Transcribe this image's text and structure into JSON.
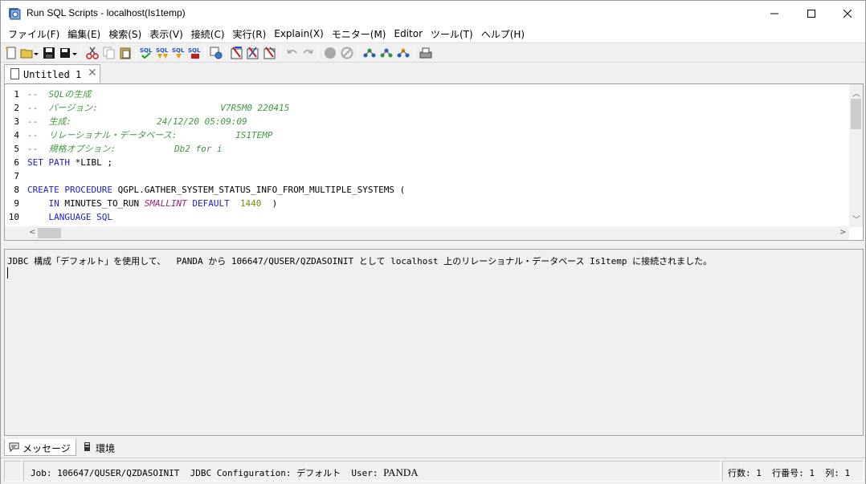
{
  "window": {
    "title": "Run SQL Scripts - localhost(Is1temp)",
    "minimize": "—",
    "maximize": "☐",
    "close": "✕"
  },
  "menu": [
    "ファイル(F)",
    "編集(E)",
    "検索(S)",
    "表示(V)",
    "接続(C)",
    "実行(R)",
    "Explain(X)",
    "モニター(M)",
    "Editor",
    "ツール(T)",
    "ヘルプ(H)"
  ],
  "tab": {
    "label": "Untitled 1",
    "close": "✕"
  },
  "editor": {
    "lines": [
      {
        "n": "1",
        "parts": [
          {
            "t": "--  SQLの生成",
            "c": "cmt"
          }
        ]
      },
      {
        "n": "2",
        "parts": [
          {
            "t": "--  バージョン:                       V7R5M0 220415",
            "c": "cmt"
          }
        ]
      },
      {
        "n": "3",
        "parts": [
          {
            "t": "--  生成:                24/12/20 05:09:09",
            "c": "cmt"
          }
        ]
      },
      {
        "n": "4",
        "parts": [
          {
            "t": "--  リレーショナル・データベース:           IS1TEMP",
            "c": "cmt"
          }
        ]
      },
      {
        "n": "5",
        "parts": [
          {
            "t": "--  規格オプション:           Db2 for i",
            "c": "cmt"
          }
        ]
      },
      {
        "n": "6",
        "parts": [
          {
            "t": "SET",
            "c": "kw"
          },
          {
            "t": " "
          },
          {
            "t": "PATH",
            "c": "kw"
          },
          {
            "t": " *LIBL ;"
          }
        ]
      },
      {
        "n": "7",
        "parts": []
      },
      {
        "n": "8",
        "parts": [
          {
            "t": "CREATE",
            "c": "kw"
          },
          {
            "t": " "
          },
          {
            "t": "PROCEDURE",
            "c": "kw"
          },
          {
            "t": " QGPL.GATHER_SYSTEM_STATUS_INFO_FROM_MULTIPLE_SYSTEMS ("
          }
        ]
      },
      {
        "n": "9",
        "parts": [
          {
            "t": "    "
          },
          {
            "t": "IN",
            "c": "kw"
          },
          {
            "t": " MINUTES_TO_RUN "
          },
          {
            "t": "SMALLINT",
            "c": "typ"
          },
          {
            "t": " "
          },
          {
            "t": "DEFAULT",
            "c": "kw"
          },
          {
            "t": "  "
          },
          {
            "t": "1440",
            "c": "num"
          },
          {
            "t": "  )"
          }
        ]
      },
      {
        "n": "10",
        "parts": [
          {
            "t": "    "
          },
          {
            "t": "LANGUAGE SQL",
            "c": "kw"
          }
        ]
      }
    ]
  },
  "messages": {
    "text": "JDBC 構成「デフォルト」を使用して、  PANDA から 106647/QUSER/QZDASOINIT として localhost 上のリレーショナル・データベース Is1temp に接続されました。"
  },
  "bottom_tabs": [
    {
      "label": "メッセージ",
      "icon": "message-icon"
    },
    {
      "label": "環境",
      "icon": "environment-icon"
    }
  ],
  "status": {
    "job": "Job: 106647/QUSER/QZDASOINIT  JDBC Configuration: デフォルト  User: ",
    "user": "PANDA",
    "position": "行数: 1  行番号: 1  列: 1"
  }
}
